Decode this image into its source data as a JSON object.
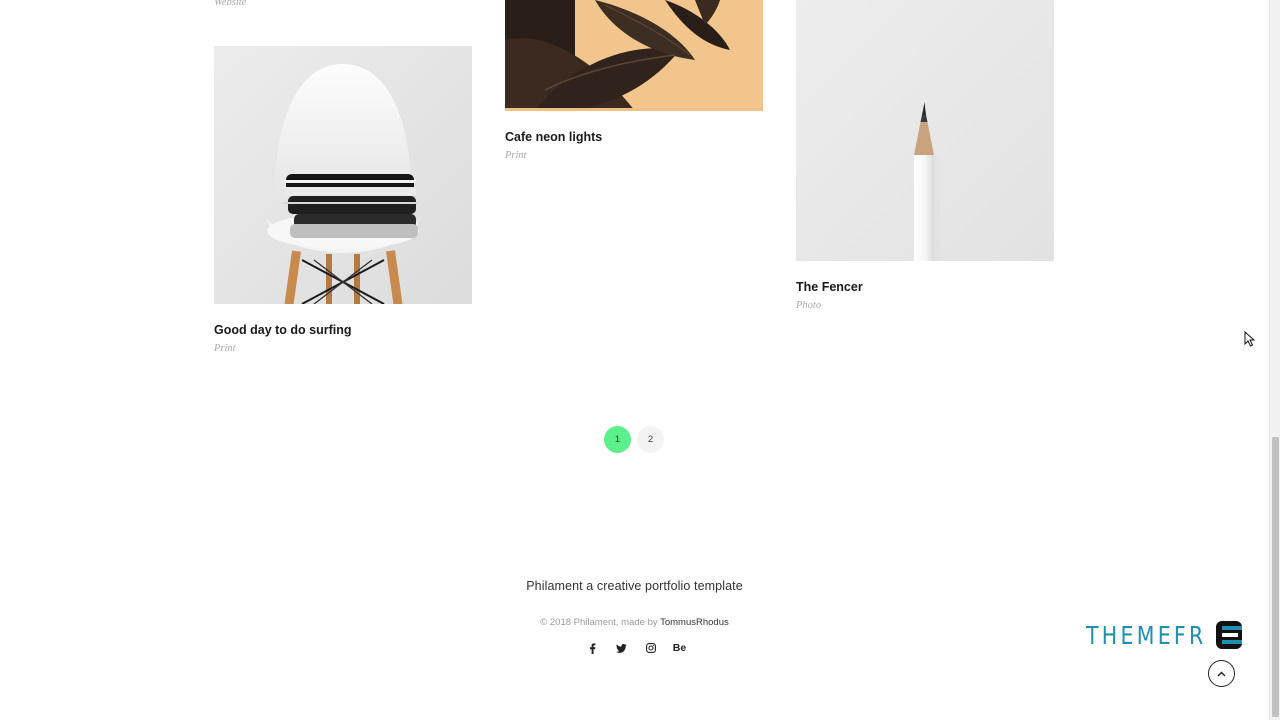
{
  "portfolio": {
    "items": [
      {
        "title": "",
        "category": "Website"
      },
      {
        "title": "Good day to do surfing",
        "category": "Print"
      },
      {
        "title": "Cafe neon lights",
        "category": "Print"
      },
      {
        "title": "The Fencer",
        "category": "Photo"
      }
    ]
  },
  "pagination": {
    "pages": [
      "1",
      "2"
    ],
    "active": "1"
  },
  "footer": {
    "title": "Philament a creative portfolio template",
    "copyright_prefix": "© 2018 Philament, made by ",
    "author": "TommusRhodus",
    "social": [
      {
        "icon": "facebook-icon",
        "glyph": "f"
      },
      {
        "icon": "twitter-icon",
        "glyph": "twitter"
      },
      {
        "icon": "instagram-icon",
        "glyph": "instagram"
      },
      {
        "icon": "behance-icon",
        "glyph": "Be"
      }
    ]
  },
  "watermark": {
    "text": "THEMEFR",
    "last_letter": "E"
  },
  "colors": {
    "accent": "#5cf08c",
    "watermark": "#1e8fb3"
  }
}
